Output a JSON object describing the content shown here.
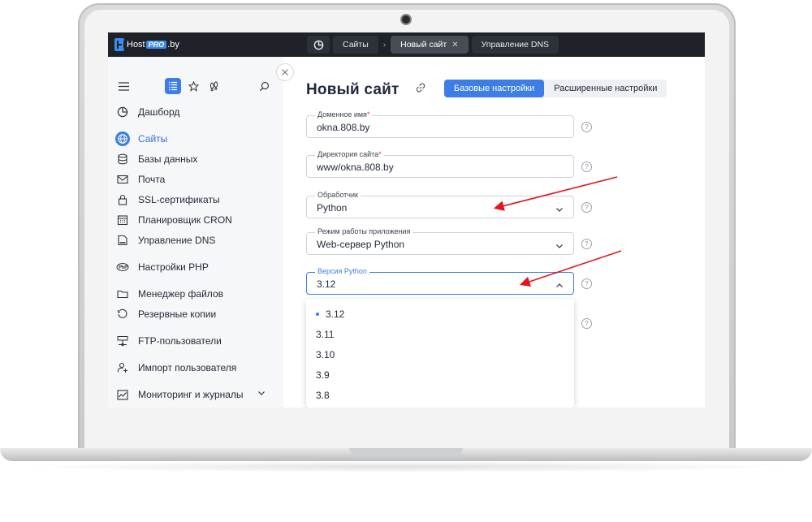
{
  "brand": {
    "logo_prefix": "Host",
    "logo_pro": "PRO",
    "logo_suffix": ".by"
  },
  "tabs": [
    {
      "label": "Сайты"
    },
    {
      "label": "Новый сайт",
      "active": true,
      "close": "✕"
    },
    {
      "label": "Управление DNS"
    }
  ],
  "breadcrumb_separator": "›",
  "sidebar": {
    "items": [
      {
        "label": "Дашборд",
        "icon": "dashboard-icon"
      },
      {
        "label": "Сайты",
        "icon": "globe-icon",
        "active": true
      },
      {
        "label": "Базы данных",
        "icon": "database-icon"
      },
      {
        "label": "Почта",
        "icon": "mail-icon"
      },
      {
        "label": "SSL-сертификаты",
        "icon": "lock-icon"
      },
      {
        "label": "Планировщик CRON",
        "icon": "calendar-icon"
      },
      {
        "label": "Управление DNS",
        "icon": "dns-icon"
      },
      {
        "label": "Настройки PHP",
        "icon": "php-icon"
      },
      {
        "label": "Менеджер файлов",
        "icon": "folder-icon"
      },
      {
        "label": "Резервные копии",
        "icon": "backup-icon"
      },
      {
        "label": "FTP-пользователи",
        "icon": "ftp-icon"
      },
      {
        "label": "Импорт пользователя",
        "icon": "import-icon"
      },
      {
        "label": "Мониторинг и журналы",
        "icon": "monitoring-icon",
        "expandable": true
      }
    ]
  },
  "main": {
    "title": "Новый сайт",
    "tabs": [
      {
        "label": "Базовые настройки",
        "active": true
      },
      {
        "label": "Расширенные настройки"
      }
    ],
    "fields": [
      {
        "label": "Доменное имя",
        "required": "*",
        "value": "okna.808.by"
      },
      {
        "label": "Директория сайта",
        "required": "*",
        "value": "www/okna.808.by"
      },
      {
        "label": "Обработчик",
        "value": "Python"
      },
      {
        "label": "Режим работы приложения",
        "value": "Web-сервер Python"
      },
      {
        "label": "Версия Python",
        "value": "3.12"
      }
    ],
    "help_symbol": "?",
    "python_versions": [
      "3.12",
      "3.11",
      "3.10",
      "3.9",
      "3.8"
    ],
    "selected_version": "3.12"
  },
  "colors": {
    "accent": "#3d7ee6",
    "topbar": "#1f2228",
    "annotation_arrow": "#e3141c"
  }
}
